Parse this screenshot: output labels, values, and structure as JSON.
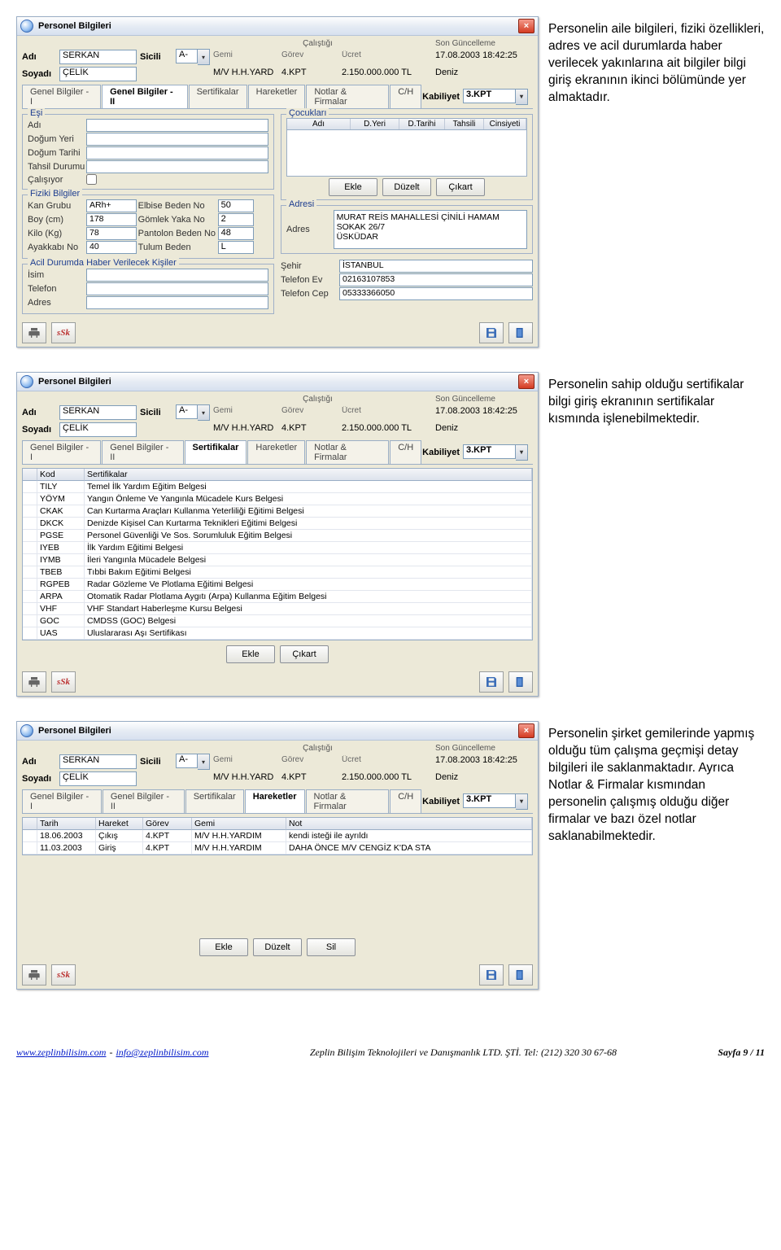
{
  "sidetext1": "Personelin aile bilgileri, fiziki özellikleri, adres ve acil durumlarda haber verilecek yakınlarına ait bilgiler bilgi giriş ekranının ikinci bölümünde yer almaktadır.",
  "sidetext2": "Personelin sahip olduğu sertifikalar bilgi giriş ekranının sertifikalar kısmında işlenebilmektedir.",
  "sidetext3": "Personelin şirket gemilerinde yapmış olduğu tüm çalışma geçmişi detay bilgileri ile saklanmaktadır. Ayrıca Notlar & Firmalar kısmından personelin çalışmış olduğu diğer firmalar ve bazı özel notlar saklanabilmektedir.",
  "dlg": {
    "title": "Personel Bilgileri",
    "hdr_labels": {
      "adi": "Adı",
      "soyadi": "Soyadı",
      "sicili": "Sicili",
      "calistigi": "Çalıştığı",
      "songun": "Son Güncelleme",
      "gemi": "Gemi",
      "gorev": "Görev",
      "ucret": "Ücret",
      "kabiliyet": "Kabiliyet"
    },
    "adi": "SERKAN",
    "soyadi": "ÇELİK",
    "sicili": "A-",
    "gemi": "M/V H.H.YARD",
    "gorev": "4.KPT",
    "ucret": "2.150.000.000 TL",
    "songun1": "17.08.2003 18:42:25",
    "songun2": "Deniz",
    "kabiliyet": "3.KPT"
  },
  "tabs": {
    "t1": "Genel Bilgiler - I",
    "t2": "Genel Bilgiler - II",
    "t3": "Sertifikalar",
    "t4": "Hareketler",
    "t5": "Notlar & Firmalar",
    "t6": "C/H"
  },
  "win1": {
    "grp_esi": "Eşi",
    "grp_coc": "Çocukları",
    "grp_fiz": "Fiziki Bilgiler",
    "grp_adr": "Adresi",
    "grp_acil": "Acil Durumda Haber Verilecek Kişiler",
    "lbl": {
      "adi": "Adı",
      "dogyeri": "Doğum Yeri",
      "dogtar": "Doğum Tarihi",
      "tahdur": "Tahsil Durumu",
      "calisiyor": "Çalışıyor",
      "kan": "Kan Grubu",
      "boy": "Boy (cm)",
      "kilo": "Kilo (Kg)",
      "ayak": "Ayakkabı No",
      "elbise": "Elbise Beden No",
      "gomlek": "Gömlek Yaka No",
      "pantolon": "Pantolon Beden No",
      "tulum": "Tulum Beden",
      "isim": "İsim",
      "telefon": "Telefon",
      "adres": "Adres",
      "sehir": "Şehir",
      "telev": "Telefon Ev",
      "telcep": "Telefon Cep"
    },
    "childhdr": {
      "adi": "Adı",
      "dyeri": "D.Yeri",
      "dtarihi": "D.Tarihi",
      "tahsili": "Tahsili",
      "cinsiyeti": "Cinsiyeti"
    },
    "fiz": {
      "kan": "ARh+",
      "boy": "178",
      "kilo": "78",
      "ayak": "40",
      "elbise": "50",
      "gomlek": "2",
      "pantolon": "48",
      "tulum": "L"
    },
    "adr": {
      "adres": "MURAT REİS MAHALLESİ ÇİNİLİ HAMAM\nSOKAK 26/7\nÜSKÜDAR",
      "sehir": "İSTANBUL",
      "telev": "02163107853",
      "telcep": "05333366050"
    },
    "btns": {
      "ekle": "Ekle",
      "duzelt": "Düzelt",
      "cikart": "Çıkart",
      "sil": "Sil"
    }
  },
  "win2": {
    "cols": {
      "kod": "Kod",
      "sert": "Sertifikalar"
    },
    "rows": [
      {
        "k": "TILY",
        "s": "Temel İlk Yardım Eğitim Belgesi"
      },
      {
        "k": "YÖYM",
        "s": "Yangın Önleme Ve Yangınla Mücadele Kurs Belgesi"
      },
      {
        "k": "CKAK",
        "s": "Can Kurtarma Araçları Kullanma Yeterliliği Eğitimi Belgesi"
      },
      {
        "k": "DKCK",
        "s": "Denizde Kişisel Can Kurtarma Teknikleri Eğitimi Belgesi"
      },
      {
        "k": "PGSE",
        "s": "Personel Güvenliği Ve Sos. Sorumluluk Eğitim Belgesi"
      },
      {
        "k": "IYEB",
        "s": "İlk Yardım Eğitimi Belgesi"
      },
      {
        "k": "IYMB",
        "s": "İleri Yangınla Mücadele Belgesi"
      },
      {
        "k": "TBEB",
        "s": "Tıbbi Bakım Eğitimi Belgesi"
      },
      {
        "k": "RGPEB",
        "s": "Radar Gözleme Ve Plotlama Eğitimi Belgesi"
      },
      {
        "k": "ARPA",
        "s": "Otomatik Radar Plotlama Aygıtı (Arpa) Kullanma Eğitim Belgesi"
      },
      {
        "k": "VHF",
        "s": "VHF Standart Haberleşme Kursu Belgesi"
      },
      {
        "k": "GOC",
        "s": "CMDSS (GOC) Belgesi"
      },
      {
        "k": "UAS",
        "s": "Uluslararası Aşı Sertifikası"
      }
    ]
  },
  "win3": {
    "cols": {
      "tarih": "Tarih",
      "hareket": "Hareket",
      "gorev": "Görev",
      "gemi": "Gemi",
      "not": "Not"
    },
    "rows": [
      {
        "t": "18.06.2003",
        "h": "Çıkış",
        "g": "4.KPT",
        "gm": "M/V H.H.YARDIM",
        "n": "kendi isteği ile ayrıldı"
      },
      {
        "t": "11.03.2003",
        "h": "Giriş",
        "g": "4.KPT",
        "gm": "M/V H.H.YARDIM",
        "n": "DAHA ÖNCE M/V CENGİZ K'DA STA"
      }
    ]
  },
  "footer": {
    "url": "www.zeplinbilisim.com",
    "mail": "info@zeplinbilisim.com",
    "mid": "Zeplin Bilişim Teknolojileri ve Danışmanlık  LTD. ŞTİ. Tel: (212) 320 30 67-68",
    "page": "Sayfa 9 / 11"
  }
}
